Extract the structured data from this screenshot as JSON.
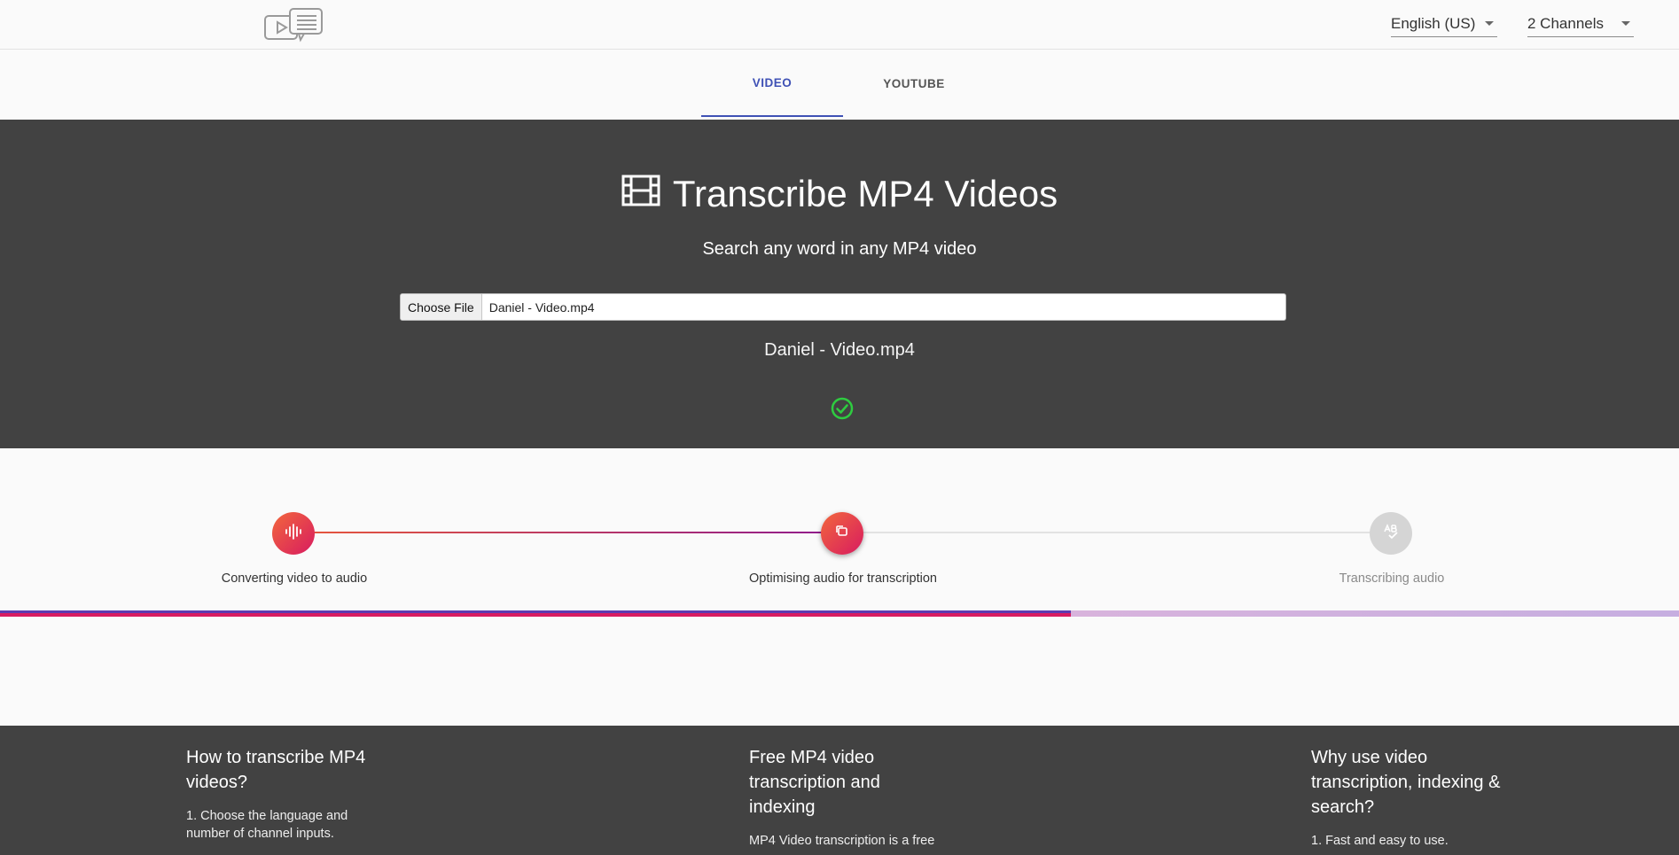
{
  "header": {
    "logo_icon": "video-transcript-logo-icon",
    "language": {
      "selected": "English (US)"
    },
    "channels": {
      "selected": "2 Channels"
    }
  },
  "tabs": [
    {
      "label": "VIDEO",
      "active": true
    },
    {
      "label": "YOUTUBE",
      "active": false
    }
  ],
  "hero": {
    "title": "Transcribe MP4 Videos",
    "title_icon": "film-icon",
    "subtitle": "Search any word in any MP4 video",
    "file_button": "Choose File",
    "file_value": "Daniel - Video.mp4",
    "file_name_display": "Daniel - Video.mp4",
    "status_icon": "check-circle-icon",
    "status_color": "#2ecc40"
  },
  "steps": [
    {
      "label": "Converting video to audio",
      "icon": "audio-wave-icon",
      "state": "done"
    },
    {
      "label": "Optimising audio for transcription",
      "icon": "optimize-icon",
      "state": "active"
    },
    {
      "label": "Transcribing audio",
      "icon": "spellcheck-icon",
      "state": "pending"
    }
  ],
  "progress": {
    "percent": 63.8,
    "accent": "#d81b60"
  },
  "footer": {
    "columns": [
      {
        "title": "How to transcribe MP4 videos?",
        "text": "1. Choose the language and number of channel inputs."
      },
      {
        "title": "Free MP4 video transcription and indexing",
        "text": "MP4 Video transcription is a free"
      },
      {
        "title": "Why use video transcription, indexing & search?",
        "text": "1. Fast and easy to use."
      }
    ]
  },
  "colors": {
    "primary": "#3f51b5",
    "hero_bg": "#424242",
    "step_gradient_start": "#f2673c",
    "step_gradient_end": "#d81b60"
  }
}
